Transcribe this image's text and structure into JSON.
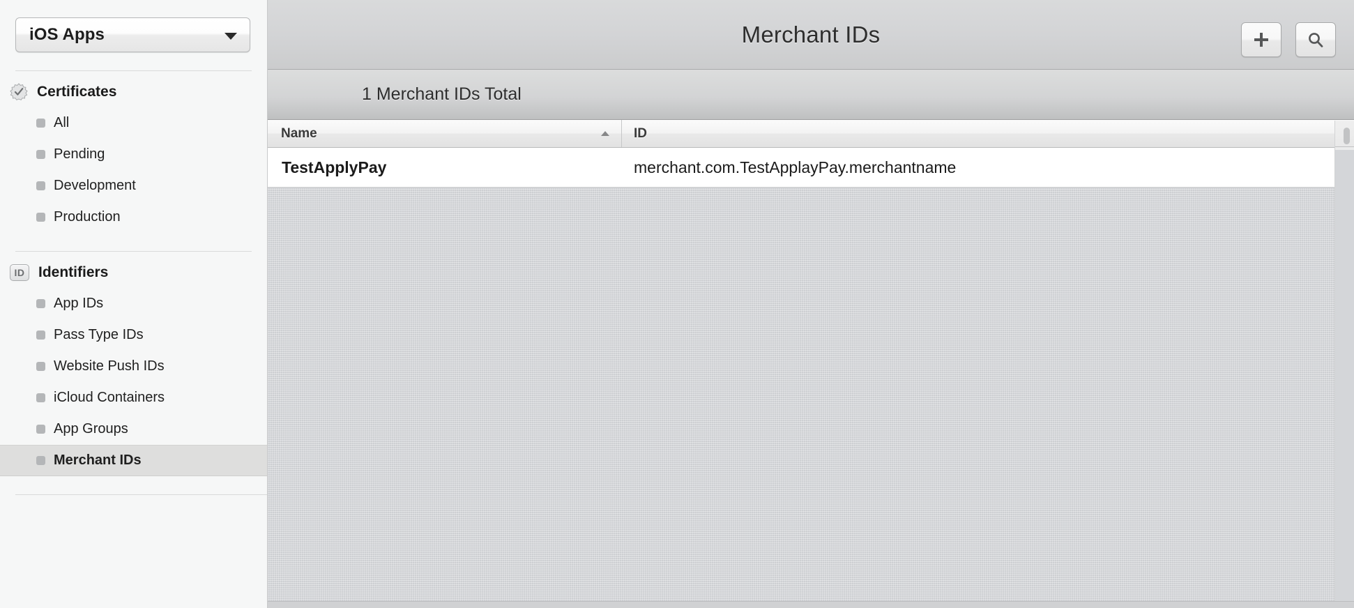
{
  "sidebar": {
    "popup": {
      "name": "team-selector",
      "value": "iOS Apps",
      "arrow_icon": "chevron-down-icon"
    },
    "groups": [
      {
        "id": "certificates",
        "icon": "certificate-seal-icon",
        "label": "Certificates",
        "items": [
          {
            "label": "All",
            "selected": false
          },
          {
            "label": "Pending",
            "selected": false
          },
          {
            "label": "Development",
            "selected": false
          },
          {
            "label": "Production",
            "selected": false
          }
        ]
      },
      {
        "id": "identifiers",
        "icon": "id-badge-icon",
        "icon_text": "ID",
        "label": "Identifiers",
        "items": [
          {
            "label": "App IDs",
            "selected": false
          },
          {
            "label": "Pass Type IDs",
            "selected": false
          },
          {
            "label": "Website Push IDs",
            "selected": false
          },
          {
            "label": "iCloud Containers",
            "selected": false
          },
          {
            "label": "App Groups",
            "selected": false
          },
          {
            "label": "Merchant IDs",
            "selected": true
          }
        ]
      }
    ]
  },
  "header": {
    "title": "Merchant IDs",
    "buttons": [
      {
        "name": "add-button",
        "icon": "plus-icon",
        "glyph": "+"
      },
      {
        "name": "search-button",
        "icon": "search-icon",
        "glyph": "search"
      }
    ]
  },
  "subheader": {
    "count_text": "1 Merchant IDs Total"
  },
  "table": {
    "columns": [
      {
        "key": "name",
        "label": "Name",
        "sorted": "ascending",
        "sort_icon": "caret-up-icon"
      },
      {
        "key": "id",
        "label": "ID",
        "sorted": "none"
      }
    ],
    "rows": [
      {
        "name": "TestApplyPay",
        "id": "merchant.com.TestApplayPay.merchantname"
      }
    ]
  },
  "colors": {
    "sidebar_bg": "#f6f7f7",
    "selected_row_bg": "#dededd",
    "titlebar_bg": "#d3d4d6",
    "canvas_bg": "#d2d4d7",
    "table_row_bg": "#ffffff",
    "text_primary": "#1b1b1b"
  }
}
